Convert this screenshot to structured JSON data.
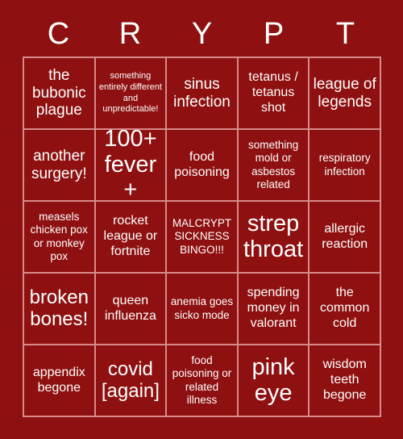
{
  "card": {
    "background_color": "#8e1010",
    "grid_line_color": "#d98a8a",
    "text_color": "#ffffff",
    "header": {
      "letters": [
        "C",
        "R",
        "Y",
        "P",
        "T"
      ]
    },
    "grid": {
      "columns": 5,
      "rows": 5,
      "cells": [
        {
          "text": "the bubonic plague",
          "size": "lg"
        },
        {
          "text": "something entirely different and unpredictable!",
          "size": "xs"
        },
        {
          "text": "sinus infection",
          "size": "lg"
        },
        {
          "text": "tetanus / tetanus shot",
          "size": "md"
        },
        {
          "text": "league of legends",
          "size": "lg"
        },
        {
          "text": "another surgery!",
          "size": "lg"
        },
        {
          "text": "100+ fever+",
          "size": "xxl"
        },
        {
          "text": "food poisoning",
          "size": "md"
        },
        {
          "text": "something mold or asbestos related",
          "size": "sm"
        },
        {
          "text": "respiratory infection",
          "size": "sm"
        },
        {
          "text": "measels chicken pox or monkey pox",
          "size": "sm"
        },
        {
          "text": "rocket league or fortnite",
          "size": "md"
        },
        {
          "text": "MALCRYPT SICKNESS BINGO!!!",
          "size": "sm"
        },
        {
          "text": "strep throat",
          "size": "xxl"
        },
        {
          "text": "allergic reaction",
          "size": "md"
        },
        {
          "text": "broken bones!",
          "size": "xl"
        },
        {
          "text": "queen influenza",
          "size": "md"
        },
        {
          "text": "anemia goes sicko mode",
          "size": "sm"
        },
        {
          "text": "spending money in valorant",
          "size": "md"
        },
        {
          "text": "the common cold",
          "size": "md"
        },
        {
          "text": "appendix begone",
          "size": "md"
        },
        {
          "text": "covid [again]",
          "size": "xl"
        },
        {
          "text": "food poisoning or related illness",
          "size": "sm"
        },
        {
          "text": "pink eye",
          "size": "xxl"
        },
        {
          "text": "wisdom teeth begone",
          "size": "md"
        }
      ]
    }
  }
}
